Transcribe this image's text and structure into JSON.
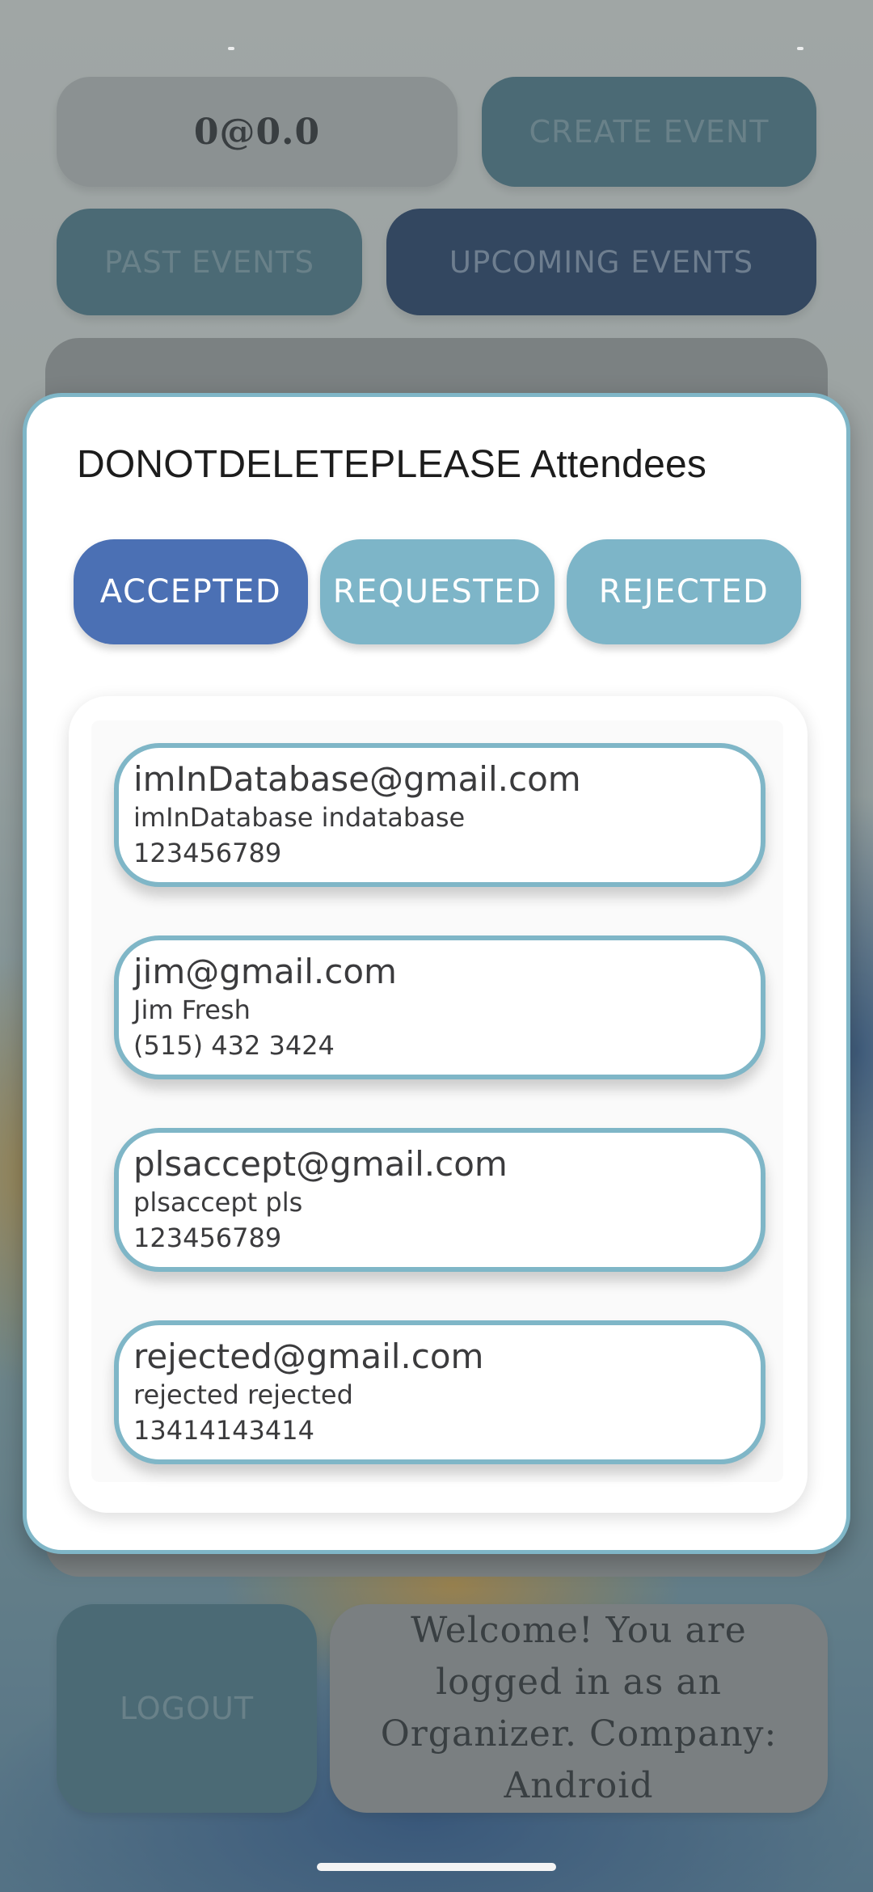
{
  "background": {
    "user_chip": "0@0.0",
    "create_event_label": "CREATE EVENT",
    "past_events_label": "PAST EVENTS",
    "upcoming_events_label": "UPCOMING EVENTS",
    "logout_label": "LOGOUT",
    "welcome_text": "Welcome! You are logged in as an Organizer. Company: Android"
  },
  "dialog": {
    "title": "DONOTDELETEPLEASE Attendees",
    "tabs": [
      {
        "label": "ACCEPTED",
        "selected": true
      },
      {
        "label": "REQUESTED",
        "selected": false
      },
      {
        "label": "REJECTED",
        "selected": false
      }
    ],
    "attendees": [
      {
        "email": "imInDatabase@gmail.com",
        "name": "imInDatabase indatabase",
        "phone": "123456789"
      },
      {
        "email": "jim@gmail.com",
        "name": "Jim Fresh",
        "phone": "(515) 432 3424"
      },
      {
        "email": "plsaccept@gmail.com",
        "name": "plsaccept pls",
        "phone": "123456789"
      },
      {
        "email": "rejected@gmail.com",
        "name": "rejected rejected",
        "phone": "13414143414"
      }
    ]
  },
  "colors": {
    "accent": "#4b70b4",
    "tab_inactive": "#7db5c8",
    "border": "#7fb6c7"
  }
}
